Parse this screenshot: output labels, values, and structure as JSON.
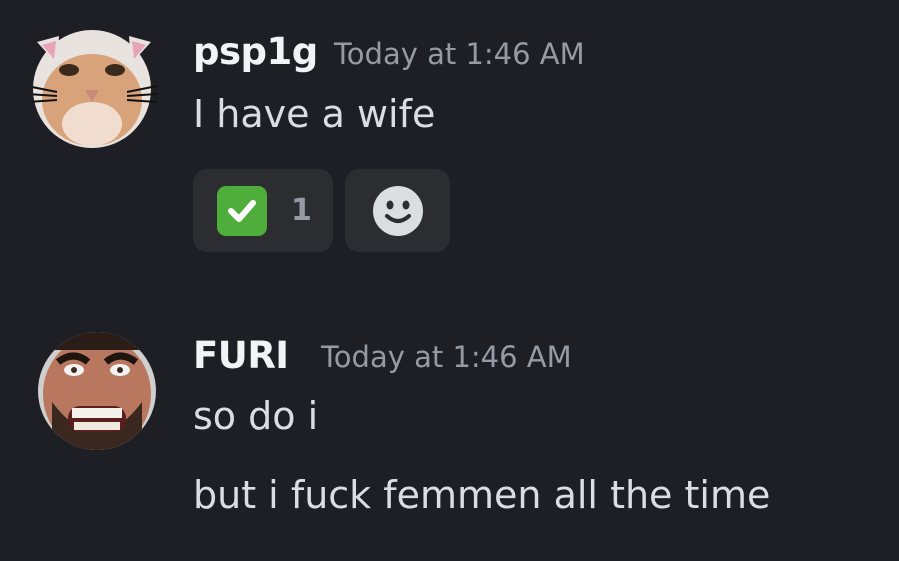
{
  "messages": [
    {
      "author": "psp1g",
      "timestamp": "Today at 1:46 AM",
      "lines": [
        "I have a wife"
      ],
      "reactions": [
        {
          "emoji": "check-mark-button",
          "count": "1"
        }
      ],
      "add_reaction_icon": "smiley-add-reaction-icon"
    },
    {
      "author": "FURI",
      "timestamp": "Today at 1:46 AM",
      "lines": [
        "so do i",
        "but i fuck femmen all the time"
      ]
    }
  ],
  "colors": {
    "background": "#1e1f24",
    "author": "#f2f3f5",
    "timestamp": "#949ba4",
    "text": "#dbdee1",
    "reaction_bg": "#2b2d31",
    "check_green": "#4fad3b"
  }
}
